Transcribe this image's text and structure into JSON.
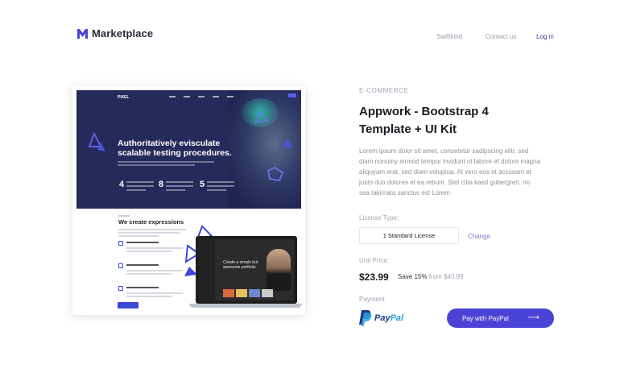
{
  "header": {
    "brand": "Marketplace",
    "nav": [
      {
        "label": "Swiftkind"
      },
      {
        "label": "Contact us"
      },
      {
        "label": "Log in"
      }
    ]
  },
  "preview": {
    "logo": "PIXEL",
    "headline": "Authoritatively evisculate scalable testing procedures.",
    "stats": [
      "4",
      "8",
      "5"
    ],
    "section_title": "We create expressions",
    "laptop_text": "Create a simple but awesome portfolio"
  },
  "product": {
    "category": "E-COMMERCE",
    "title": "Appwork - Bootstrap 4 Template + UI Kit",
    "description": "Lorem ipsum dolor sit amet, consetetur sadipscing elitr, sed diam nonumy eirmod tempor invidunt ut labore et dolore magna aliquyam erat, sed diam voluptua. At vero eos et accusam et justo duo dolores et ea rebum. Stet clita kasd gubergren, no sea takimata sanctus est Lorem",
    "license_label": "License Type:",
    "license_value": "1 Standard License",
    "change_label": "Change",
    "unit_price_label": "Unit Price:",
    "price": "$23.99",
    "save_prefix": "Save",
    "save_pct": "15%",
    "save_from": "from $43.99",
    "payment_label": "Payment",
    "paypal_p1": "Pay",
    "paypal_p2": "Pal",
    "pay_button": "Pay with PayPal",
    "pay_arrow": "⟶"
  },
  "colors": {
    "accent": "#4a44d6",
    "brand_dark": "#27283c",
    "muted": "#a3a3b3",
    "hero_bg": "#242a5a"
  }
}
